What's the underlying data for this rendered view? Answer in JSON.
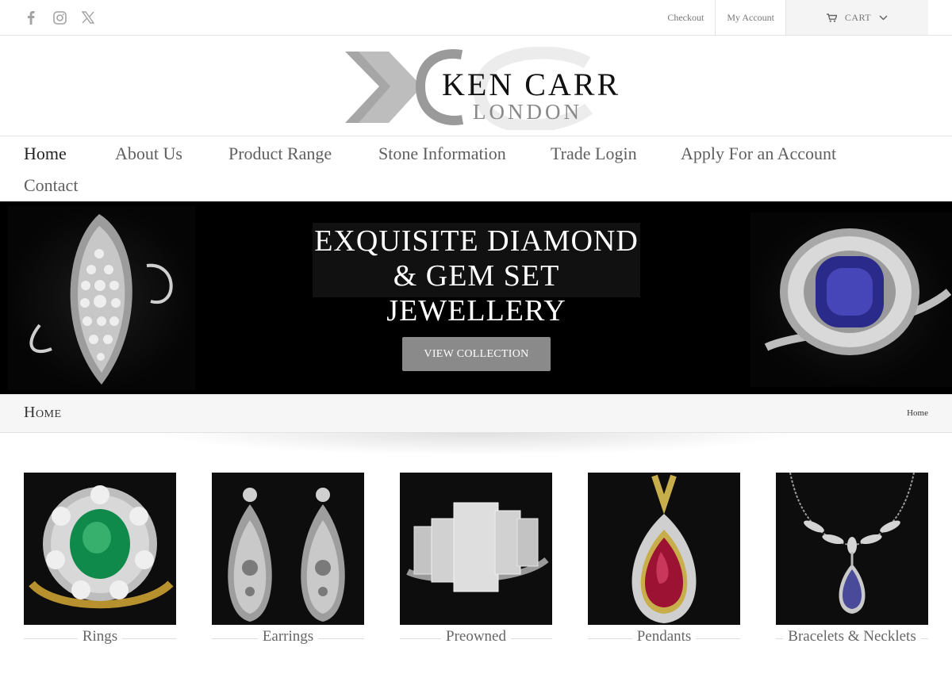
{
  "topbar": {
    "social": [
      "facebook-icon",
      "instagram-icon",
      "x-icon"
    ],
    "links": {
      "checkout": "Checkout",
      "account": "My Account",
      "cart": "CART"
    }
  },
  "header": {
    "logo_line1": "KEN CARR",
    "logo_line2": "LONDON"
  },
  "nav": {
    "items": [
      "Home",
      "About Us",
      "Product Range",
      "Stone Information",
      "Trade Login",
      "Apply For an Account",
      "Contact"
    ]
  },
  "hero": {
    "title_line1": "EXQUISITE DIAMOND",
    "title_line2": "& GEM SET JEWELLERY",
    "button": "VIEW COLLECTION"
  },
  "page": {
    "title": "Home",
    "breadcrumb": "Home"
  },
  "categories": [
    {
      "label": "Rings",
      "stone_color": "#0f8a4a"
    },
    {
      "label": "Earrings",
      "stone_color": "#c9c9c9"
    },
    {
      "label": "Preowned",
      "stone_color": "#d8d8d8"
    },
    {
      "label": "Pendants",
      "stone_color": "#9b1233"
    },
    {
      "label": "Bracelets & Necklets",
      "stone_color": "#4a4a9a"
    }
  ],
  "colors": {
    "sapphire": "#2a2a8a",
    "emerald": "#0f8a4a",
    "ruby": "#9b1233",
    "button": "#8a8a8a"
  }
}
